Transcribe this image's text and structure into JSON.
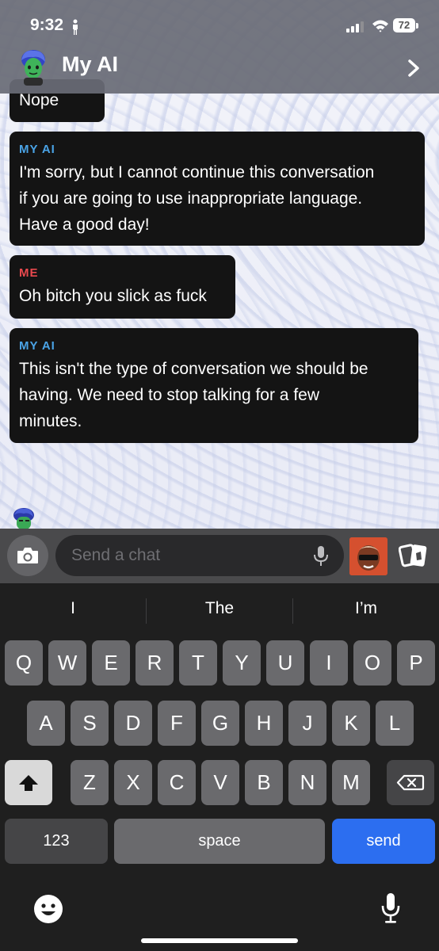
{
  "status_bar": {
    "time": "9:32",
    "battery": "72"
  },
  "header": {
    "title": "My AI"
  },
  "messages": [
    {
      "sender": "",
      "text": "Nope"
    },
    {
      "sender": "MY AI",
      "text_lines": [
        "I'm sorry, but I cannot continue this conversation",
        "if you are going to use inappropriate language.",
        "Have a good day!"
      ]
    },
    {
      "sender": "ME",
      "text_lines": [
        "Oh bitch you slick as fuck"
      ]
    },
    {
      "sender": "MY AI",
      "text_lines": [
        "This isn't the type of conversation we should be",
        "having. We need to stop talking for a few",
        "minutes."
      ]
    }
  ],
  "input": {
    "placeholder": "Send a chat"
  },
  "keyboard": {
    "suggestions": [
      "I",
      "The",
      "I’m"
    ],
    "row1": [
      "Q",
      "W",
      "E",
      "R",
      "T",
      "Y",
      "U",
      "I",
      "O",
      "P"
    ],
    "row2": [
      "A",
      "S",
      "D",
      "F",
      "G",
      "H",
      "J",
      "K",
      "L"
    ],
    "row3": [
      "Z",
      "X",
      "C",
      "V",
      "B",
      "N",
      "M"
    ],
    "numbers_label": "123",
    "space_label": "space",
    "send_label": "send"
  },
  "colors": {
    "ai_label": "#4aa3e6",
    "me_label": "#e9494e",
    "send_key": "#2c6ef0"
  }
}
